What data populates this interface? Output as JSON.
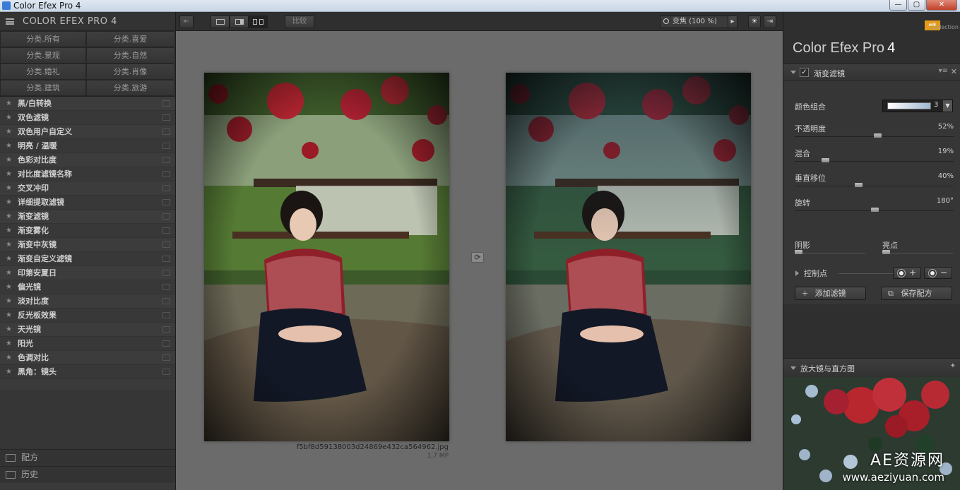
{
  "window": {
    "title": "Color Efex Pro 4",
    "min": "—",
    "max": "▢",
    "close": "✕"
  },
  "left": {
    "brand": "COLOR EFEX PRO 4",
    "categories": [
      "分类.所有",
      "分类.喜爱",
      "分类.景观",
      "分类.自然",
      "分类.婚礼",
      "分类.肖像",
      "分类.建筑",
      "分类.旅游"
    ],
    "filters": [
      "黑/白转换",
      "双色滤镜",
      "双色用户自定义",
      "明亮 / 温暖",
      "色彩对比度",
      "对比度滤镜名称",
      "交叉冲印",
      "详细提取滤镜",
      "渐变滤镜",
      "渐变雾化",
      "渐变中灰镜",
      "渐变自定义滤镜",
      "印第安夏日",
      "偏光镜",
      "淡对比度",
      "反光板效果",
      "天光镜",
      "阳光",
      "色调对比",
      "黑角：镜头"
    ],
    "tabs": {
      "recipes": "配方",
      "history": "历史"
    }
  },
  "toolbar": {
    "compare": "比较",
    "zoom": "变焦 (100 %)"
  },
  "image": {
    "filename": "f5bf8d59138003d24869e432ca564962.jpg",
    "size": "1.7 MP"
  },
  "right": {
    "product": "Color Efex Pro",
    "version": "4",
    "nik_badge": "nik",
    "nik_collection": "Collection",
    "filter": {
      "name": "渐变滤镜",
      "color_combo": {
        "label": "颜色组合",
        "value": "3"
      },
      "params": [
        {
          "label": "不透明度",
          "value": "52%",
          "level": 0.52
        },
        {
          "label": "混合",
          "value": "19%",
          "level": 0.19
        },
        {
          "label": "垂直移位",
          "value": "40%",
          "level": 0.4
        },
        {
          "label": "旋转",
          "value": "180°",
          "level": 0.5
        }
      ],
      "shadows": {
        "label": "阴影",
        "level": 0
      },
      "highlights": {
        "label": "亮点",
        "level": 0
      },
      "control_points": "控制点",
      "add_filter": "添加滤镜",
      "save_recipe": "保存配方"
    },
    "loupe": "放大镜与直方图",
    "watermark": "AE资源网",
    "watermark_url": "www.aeziyuan.com"
  },
  "colors": {
    "panel": "#3a3a3a",
    "canvas": "#6b6b6b",
    "accent": "#e49b1a"
  }
}
